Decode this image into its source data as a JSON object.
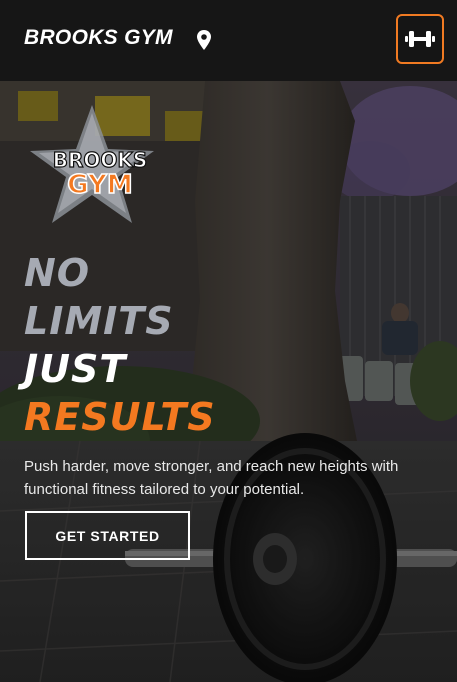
{
  "header": {
    "brand": "BROOKS GYM",
    "location_icon": "map-pin-icon",
    "menu_icon": "dumbbell-icon"
  },
  "hero": {
    "logo": {
      "line1": "BROOKS",
      "line2": "GYM"
    },
    "headline": [
      "NO",
      "LIMITS",
      "JUST",
      "RESULTS"
    ],
    "subtext": "Push harder, move stronger, and reach new heights with functional fitness tailored to your potential.",
    "cta_label": "GET STARTED"
  },
  "colors": {
    "accent": "#f47920",
    "header_bg": "#161616",
    "headline_muted": "#a6aab3",
    "headline_white": "#ffffff"
  }
}
